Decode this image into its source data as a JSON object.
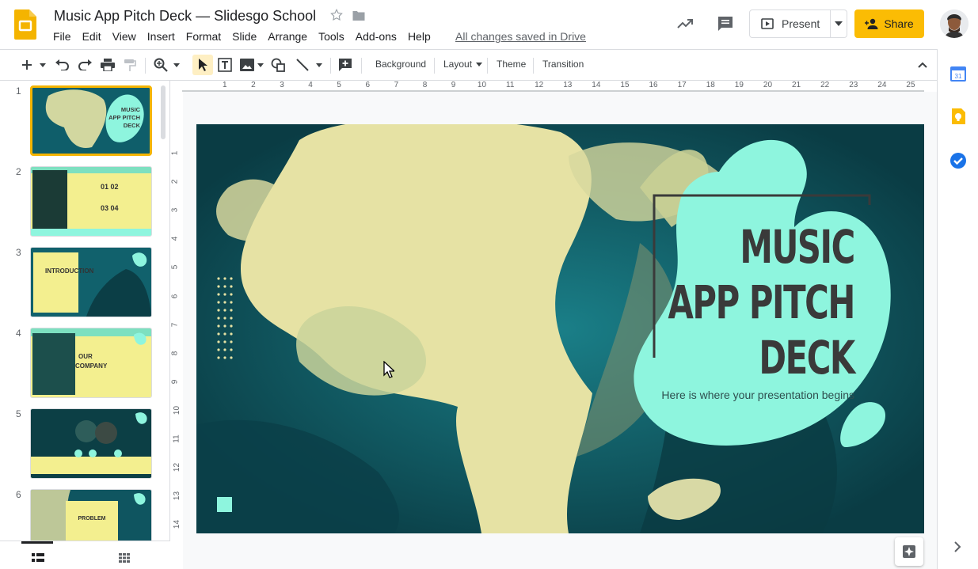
{
  "doc": {
    "title": "Music App Pitch Deck — Slidesgo School",
    "saved_status": "All changes saved in Drive"
  },
  "menu": [
    "File",
    "Edit",
    "View",
    "Insert",
    "Format",
    "Slide",
    "Arrange",
    "Tools",
    "Add-ons",
    "Help"
  ],
  "header": {
    "present_label": "Present",
    "share_label": "Share"
  },
  "toolbar": {
    "background_label": "Background",
    "layout_label": "Layout",
    "theme_label": "Theme",
    "transition_label": "Transition"
  },
  "ruler": {
    "h_ticks": [
      "1",
      "2",
      "3",
      "4",
      "5",
      "6",
      "7",
      "8",
      "9",
      "10",
      "11",
      "12",
      "13",
      "14",
      "15",
      "16",
      "17",
      "18",
      "19",
      "20",
      "21",
      "22",
      "23",
      "24",
      "25"
    ],
    "v_ticks": [
      "1",
      "2",
      "3",
      "4",
      "5",
      "6",
      "7",
      "8",
      "9",
      "10",
      "11",
      "12",
      "13",
      "14"
    ]
  },
  "filmstrip": {
    "slides": [
      {
        "num": "1",
        "label": "MUSIC APP PITCH DECK"
      },
      {
        "num": "2",
        "label": "01 02 03 04"
      },
      {
        "num": "3",
        "label": "INTRODUCTION"
      },
      {
        "num": "4",
        "label": "OUR COMPANY"
      },
      {
        "num": "5",
        "label": ""
      },
      {
        "num": "6",
        "label": "PROBLEM"
      }
    ]
  },
  "slide": {
    "title_lines": [
      "MUSIC",
      "APP PITCH",
      "DECK"
    ],
    "subtitle": "Here is where your presentation begins"
  },
  "colors": {
    "accent_yellow": "#fbbc04",
    "slide_teal": "#0e5a66",
    "slide_mint": "#8ef5de",
    "slide_cream": "#e8e4a6"
  }
}
